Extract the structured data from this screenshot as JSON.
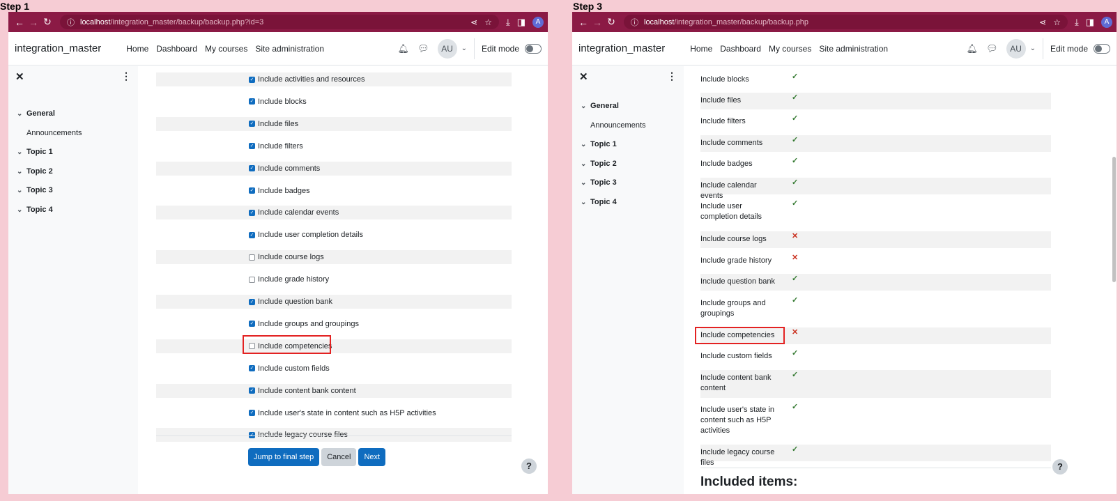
{
  "step1": {
    "label": "Step 1",
    "browser": {
      "url_host": "localhost",
      "url_path": "/integration_master/backup/backup.php?id=3"
    },
    "navbar": {
      "brand": "integration_master",
      "links": [
        "Home",
        "Dashboard",
        "My courses",
        "Site administration"
      ],
      "avatar": "AU",
      "edit_mode": "Edit mode"
    },
    "drawer": {
      "items": [
        "General",
        "Announcements",
        "Topic 1",
        "Topic 2",
        "Topic 3",
        "Topic 4"
      ]
    },
    "settings": [
      {
        "label": "Include activities and resources",
        "checked": true
      },
      {
        "label": "Include blocks",
        "checked": true
      },
      {
        "label": "Include files",
        "checked": true
      },
      {
        "label": "Include filters",
        "checked": true
      },
      {
        "label": "Include comments",
        "checked": true
      },
      {
        "label": "Include badges",
        "checked": true
      },
      {
        "label": "Include calendar events",
        "checked": true
      },
      {
        "label": "Include user completion details",
        "checked": true
      },
      {
        "label": "Include course logs",
        "checked": false
      },
      {
        "label": "Include grade history",
        "checked": false
      },
      {
        "label": "Include question bank",
        "checked": true
      },
      {
        "label": "Include groups and groupings",
        "checked": true
      },
      {
        "label": "Include competencies",
        "checked": false
      },
      {
        "label": "Include custom fields",
        "checked": true
      },
      {
        "label": "Include content bank content",
        "checked": true
      },
      {
        "label": "Include user's state in content such as H5P activities",
        "checked": true
      },
      {
        "label": "Include legacy course files",
        "checked": true
      }
    ],
    "buttons": {
      "jump": "Jump to final step",
      "cancel": "Cancel",
      "next": "Next"
    },
    "help": "?"
  },
  "step3": {
    "label": "Step 3",
    "browser": {
      "url_host": "localhost",
      "url_path": "/integration_master/backup/backup.php"
    },
    "navbar": {
      "brand": "integration_master",
      "links": [
        "Home",
        "Dashboard",
        "My courses",
        "Site administration"
      ],
      "avatar": "AU",
      "edit_mode": "Edit mode"
    },
    "drawer": {
      "items": [
        "General",
        "Announcements",
        "Topic 1",
        "Topic 2",
        "Topic 3",
        "Topic 4"
      ]
    },
    "settings": [
      {
        "label": "Include blocks",
        "included": true
      },
      {
        "label": "Include files",
        "included": true
      },
      {
        "label": "Include filters",
        "included": true
      },
      {
        "label": "Include comments",
        "included": true
      },
      {
        "label": "Include badges",
        "included": true
      },
      {
        "label": "Include calendar events",
        "included": true
      },
      {
        "label": "Include user completion details",
        "included": true
      },
      {
        "label": "Include course logs",
        "included": false
      },
      {
        "label": "Include grade history",
        "included": false
      },
      {
        "label": "Include question bank",
        "included": true
      },
      {
        "label": "Include groups and groupings",
        "included": true
      },
      {
        "label": "Include competencies",
        "included": false
      },
      {
        "label": "Include custom fields",
        "included": true
      },
      {
        "label": "Include content bank content",
        "included": true
      },
      {
        "label": "Include user's state in content such as H5P activities",
        "included": true
      },
      {
        "label": "Include legacy course files",
        "included": true
      }
    ],
    "included_heading": "Included items:",
    "help": "?"
  },
  "colors": {
    "chrome": "#8b1a45",
    "primary": "#0f6cbf",
    "highlight": "#e32222",
    "yes": "#357a32",
    "no": "#ca3120"
  }
}
